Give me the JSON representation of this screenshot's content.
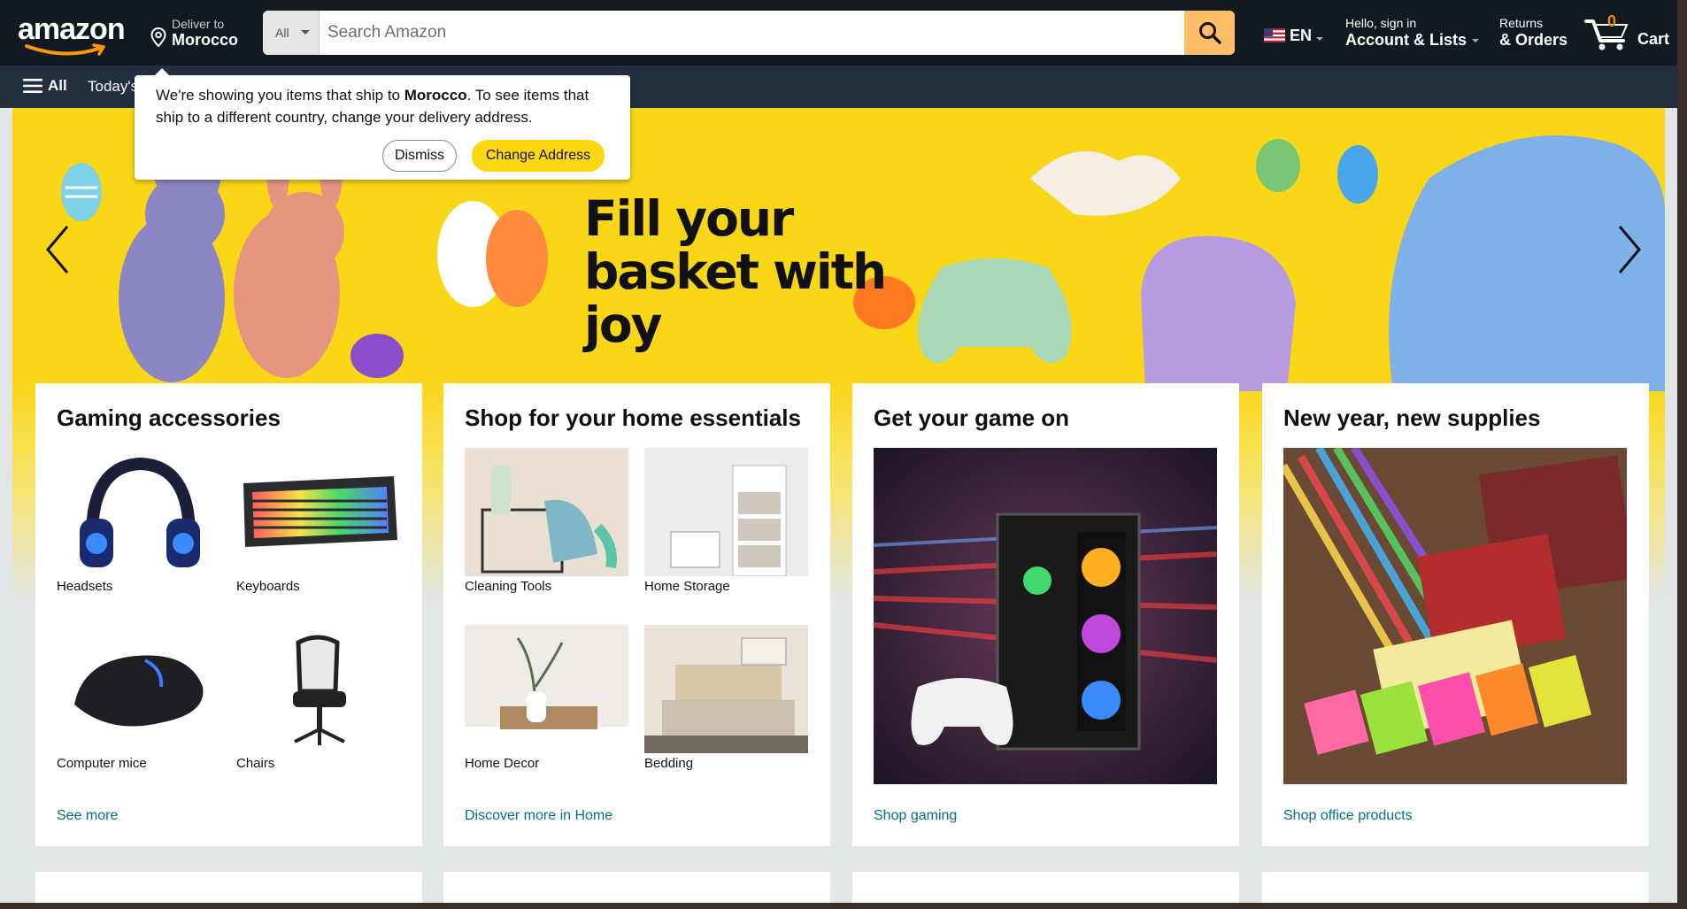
{
  "header": {
    "logo_text": "amazon",
    "deliver_to_label": "Deliver to",
    "deliver_to_location": "Morocco",
    "search_category": "All",
    "search_placeholder": "Search Amazon",
    "language": "EN",
    "account_greeting": "Hello, sign in",
    "account_label": "Account & Lists",
    "returns_label": "Returns",
    "orders_label": "& Orders",
    "cart_count": "0",
    "cart_label": "Cart"
  },
  "subnav": {
    "all_label": "All",
    "todays_deals_partial": "Today's"
  },
  "popover": {
    "message_prefix": "We're showing you items that ship to ",
    "message_country": "Morocco",
    "message_suffix": ". To see items that ship to a different country, change your delivery address.",
    "dismiss_label": "Dismiss",
    "change_label": "Change Address"
  },
  "hero": {
    "title": "Fill your basket with joy"
  },
  "cards": [
    {
      "title": "Gaming accessories",
      "items": [
        "Headsets",
        "Keyboards",
        "Computer mice",
        "Chairs"
      ],
      "link": "See more"
    },
    {
      "title": "Shop for your home essentials",
      "items": [
        "Cleaning Tools",
        "Home Storage",
        "Home Decor",
        "Bedding"
      ],
      "link": "Discover more in Home"
    },
    {
      "title": "Get your game on",
      "link": "Shop gaming"
    },
    {
      "title": "New year, new supplies",
      "link": "Shop office products"
    }
  ],
  "colors": {
    "nav_bg": "#131921",
    "subnav_bg": "#232f3e",
    "search_button": "#febd69",
    "hero_yellow": "#f9d616",
    "link": "#007185",
    "cart_count": "#f08804",
    "change_button": "#ffd814"
  },
  "icons": [
    "location-pin-icon",
    "search-icon",
    "us-flag-icon",
    "cart-icon",
    "hamburger-icon",
    "chevron-left-icon",
    "chevron-right-icon"
  ]
}
